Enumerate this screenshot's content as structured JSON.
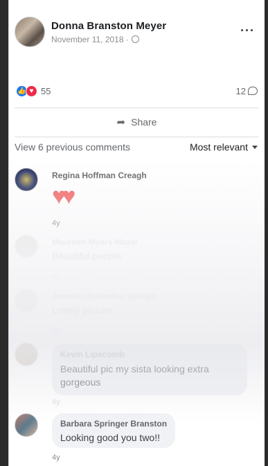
{
  "post": {
    "author": "Donna Branston Meyer",
    "date": "November 11, 2018 ·",
    "privacy_icon": "globe-icon",
    "more_icon": "more-dots-icon"
  },
  "reactions": {
    "count": "55",
    "types": [
      "like-icon",
      "love-icon"
    ],
    "comments_count": "12"
  },
  "actions": {
    "share_label": "Share"
  },
  "comments_bar": {
    "view_previous": "View 6 previous comments",
    "sort_label": "Most relevant"
  },
  "comments": [
    {
      "name": "Regina Hoffman Creagh",
      "text": "",
      "time": "4y"
    },
    {
      "name": "Maureen Myers Mazel",
      "text": "Beautiful people",
      "time": "4y"
    },
    {
      "name": "Jennifer Schindler Spiegel",
      "text": "Lovely picture",
      "time": "4y"
    },
    {
      "name": "Kevin Lipscomb",
      "text": "Beautiful pic my sista looking extra gorgeous",
      "time": "4y"
    },
    {
      "name": "Barbara Springer Branston",
      "text": "Looking good you two!!",
      "time": "4y"
    }
  ],
  "colors": {
    "like": "#1877f2",
    "love": "#f02849",
    "secondary_text": "#65676b"
  }
}
